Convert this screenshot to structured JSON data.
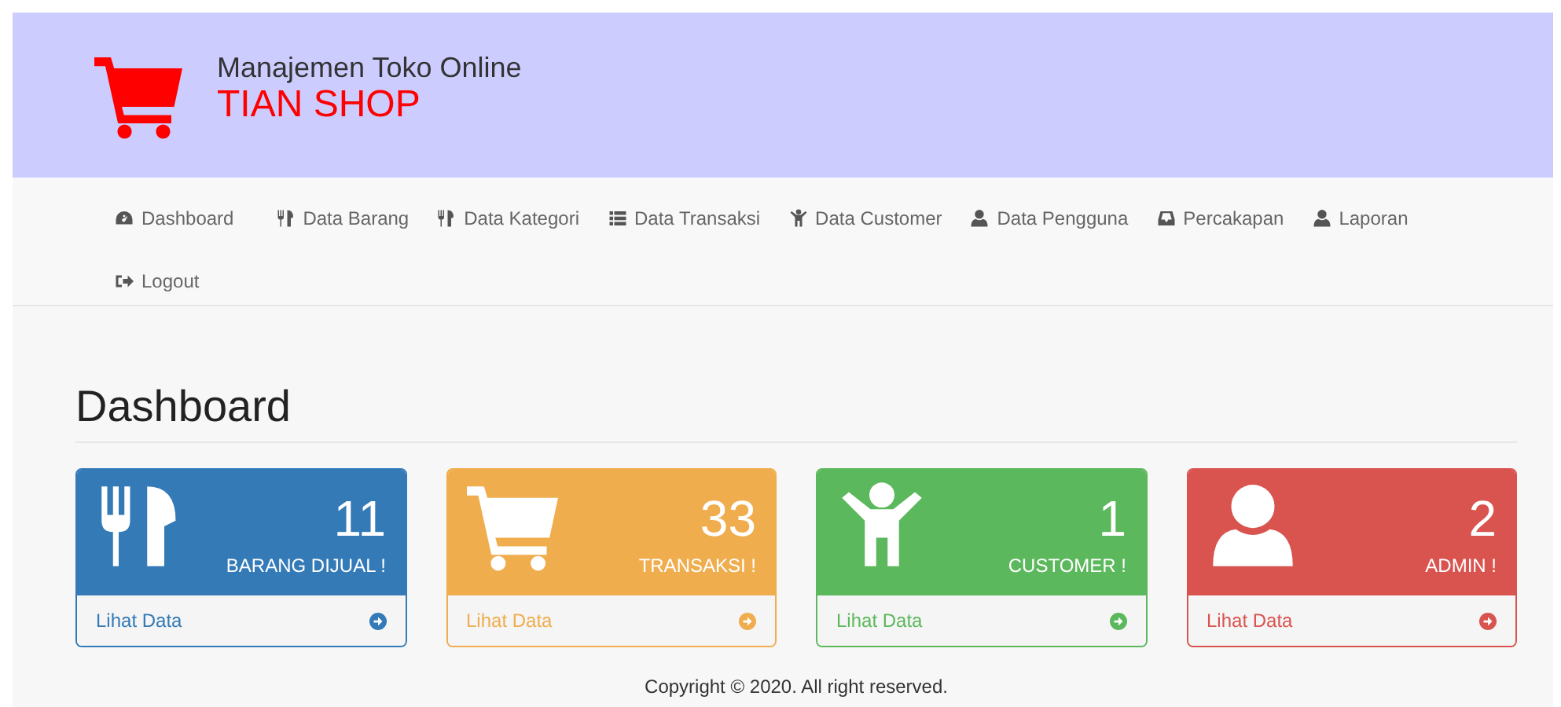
{
  "header": {
    "subtitle": "Manajemen Toko Online",
    "title": "TIAN SHOP"
  },
  "nav": [
    {
      "label": "Dashboard"
    },
    {
      "label": "Data Barang"
    },
    {
      "label": "Data Kategori"
    },
    {
      "label": "Data Transaksi"
    },
    {
      "label": "Data Customer"
    },
    {
      "label": "Data Pengguna"
    },
    {
      "label": "Percakapan"
    },
    {
      "label": "Laporan"
    },
    {
      "label": "Logout"
    }
  ],
  "page_title": "Dashboard",
  "panels": [
    {
      "count": "11",
      "label": "BARANG DIJUAL !",
      "link": "Lihat Data",
      "color": "#337ab7"
    },
    {
      "count": "33",
      "label": "TRANSAKSI !",
      "link": "Lihat Data",
      "color": "#f0ad4e"
    },
    {
      "count": "1",
      "label": "CUSTOMER !",
      "link": "Lihat Data",
      "color": "#5cb85c"
    },
    {
      "count": "2",
      "label": "ADMIN !",
      "link": "Lihat Data",
      "color": "#d9534f"
    }
  ],
  "footer": "Copyright © 2020. All right reserved."
}
